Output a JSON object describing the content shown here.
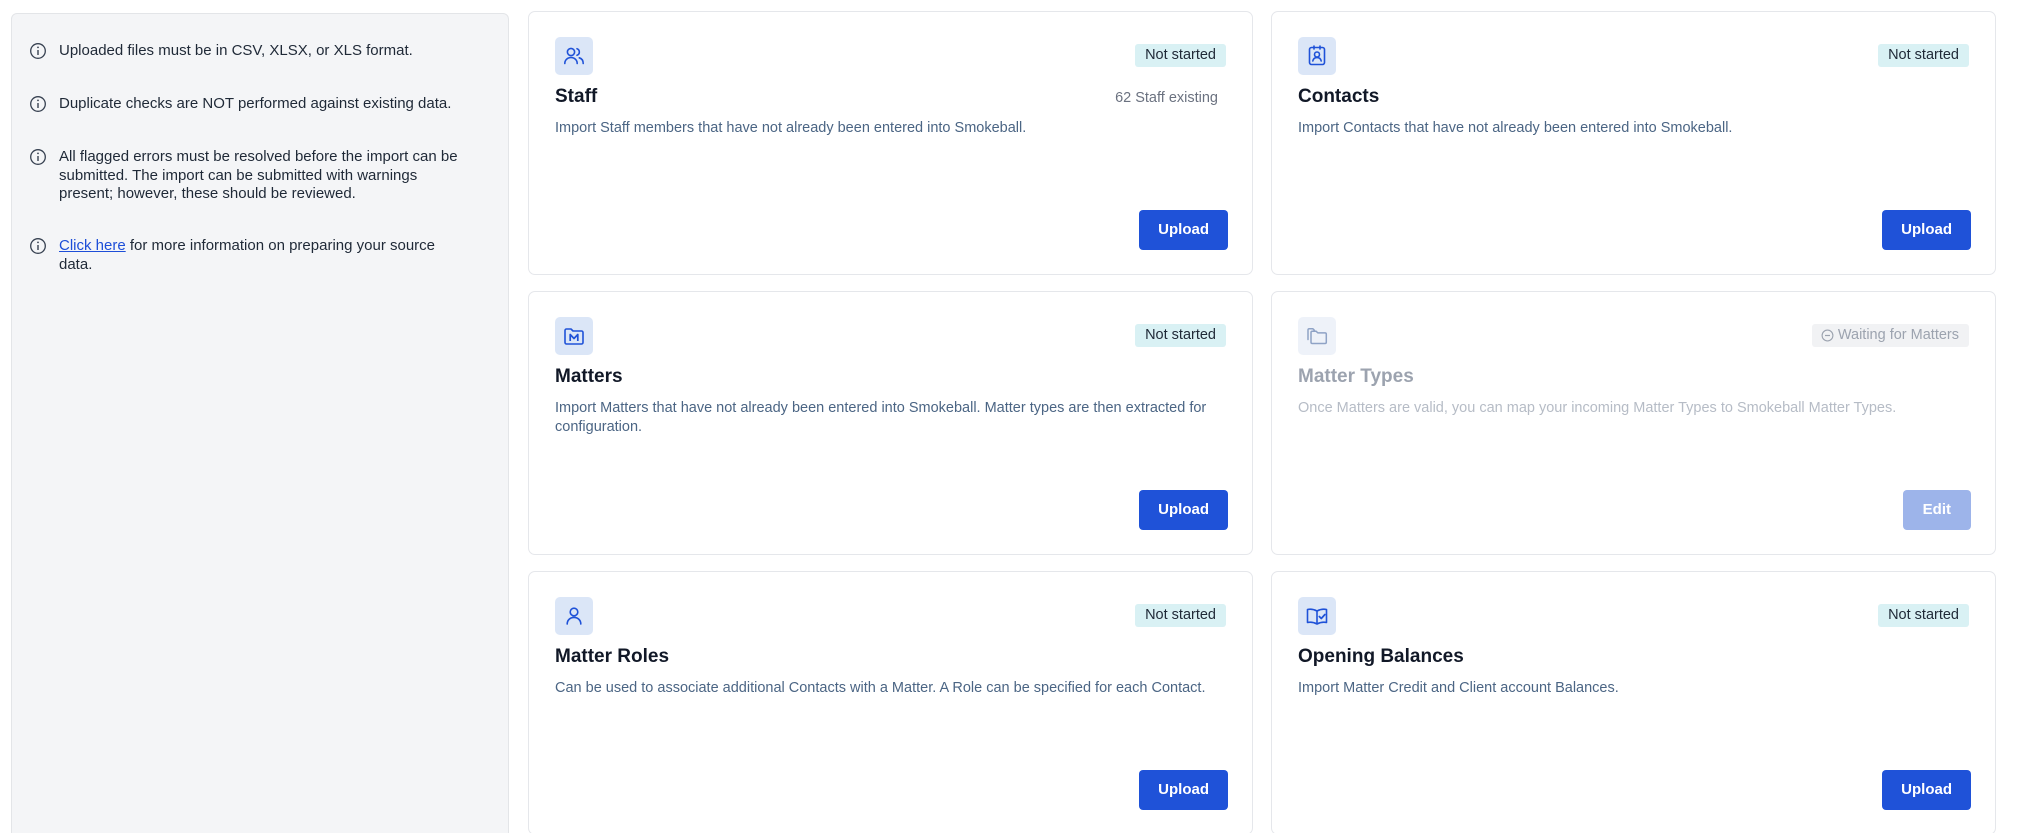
{
  "sidebar": {
    "notes": [
      {
        "text": "Uploaded files must be in CSV, XLSX, or XLS format."
      },
      {
        "text": "Duplicate checks are NOT performed against existing data."
      },
      {
        "text": "All flagged errors must be resolved before the import can be submitted. The import can be submitted with warnings present; however, these should be reviewed."
      },
      {
        "link": "Click here",
        "text": " for more information on preparing your source data."
      }
    ],
    "note_icon": "info-circle-icon"
  },
  "cards": {
    "staff": {
      "icon": "users-icon",
      "title": "Staff",
      "status": "Not started",
      "count": "62 Staff existing",
      "description": "Import Staff members that have not already been entered into Smokeball.",
      "button": "Upload"
    },
    "contacts": {
      "icon": "contact-card-icon",
      "title": "Contacts",
      "status": "Not started",
      "description": "Import Contacts that have not already been entered into Smokeball.",
      "button": "Upload"
    },
    "matters": {
      "icon": "matter-folder-icon",
      "title": "Matters",
      "status": "Not started",
      "description": "Import Matters that have not already been entered into Smokeball. Matter types are then extracted for configuration.",
      "button": "Upload"
    },
    "matter_types": {
      "icon": "folders-icon",
      "title": "Matter Types",
      "status": "Waiting for Matters",
      "status_icon": "waiting-clock-icon",
      "description": "Once Matters are valid, you can map your incoming Matter Types to Smokeball Matter Types.",
      "button": "Edit"
    },
    "matter_roles": {
      "icon": "person-icon",
      "title": "Matter Roles",
      "status": "Not started",
      "description": "Can be used to associate additional Contacts with a Matter. A Role can be specified for each Contact.",
      "button": "Upload"
    },
    "opening_balances": {
      "icon": "ledger-check-icon",
      "title": "Opening Balances",
      "status": "Not started",
      "description": "Import Matter Credit and Client account Balances.",
      "button": "Upload"
    }
  },
  "colors": {
    "accent": "#1f52d8",
    "badge_bg": "#d9f1f4",
    "icon_tile_bg": "#dbe6f7"
  }
}
